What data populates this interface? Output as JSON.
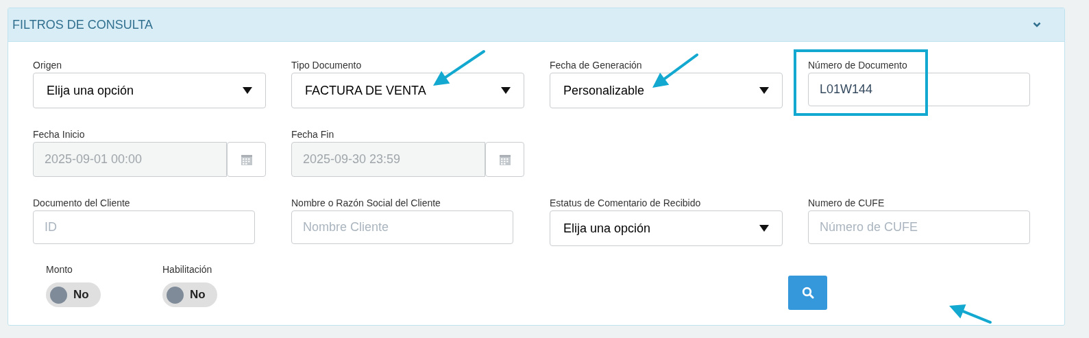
{
  "panel": {
    "title": "FILTROS DE CONSULTA"
  },
  "rows": [
    [
      {
        "kind": "select",
        "label": "Origen",
        "value": "Elija una opción"
      },
      {
        "kind": "select",
        "label": "Tipo Documento",
        "value": "FACTURA DE VENTA"
      },
      {
        "kind": "select",
        "label": "Fecha de Generación",
        "value": "Personalizable"
      },
      {
        "kind": "input",
        "label": "Número de Documento",
        "value": "L01W144"
      }
    ],
    [
      {
        "kind": "date",
        "label": "Fecha Inicio",
        "value": "2025-09-01 00:00",
        "disabled": true
      },
      {
        "kind": "date",
        "label": "Fecha Fin",
        "value": "2025-09-30 23:59",
        "disabled": true
      }
    ],
    [
      {
        "kind": "input",
        "label": "Documento del Cliente",
        "placeholder": "ID"
      },
      {
        "kind": "input",
        "label": "Nombre o Razón Social del Cliente",
        "placeholder": "Nombre Cliente"
      },
      {
        "kind": "select",
        "label": "Estatus de Comentario de Recibido",
        "value": "Elija una opción"
      },
      {
        "kind": "input",
        "label": "Numero de CUFE",
        "placeholder": "Número de CUFE"
      }
    ]
  ],
  "toggles": [
    {
      "label": "Monto",
      "on": false,
      "text": "No"
    },
    {
      "label": "Habilitación",
      "on": false,
      "text": "No"
    }
  ]
}
